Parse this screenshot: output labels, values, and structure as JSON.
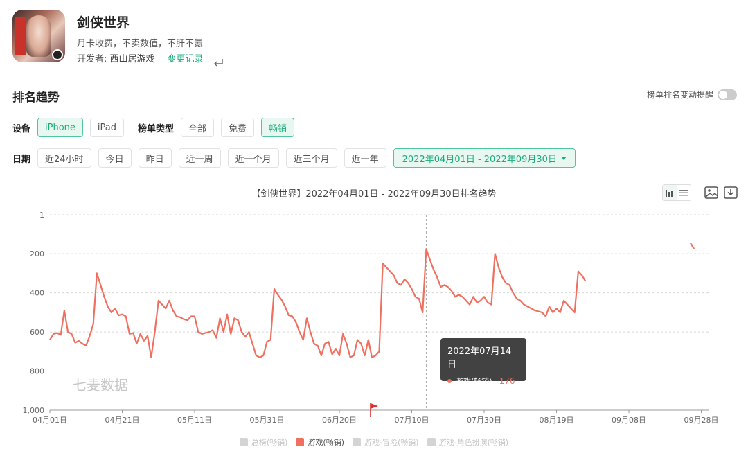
{
  "app": {
    "title": "剑侠世界",
    "description": "月卡收费，不卖数值，不肝不氪",
    "developer_label": "开发者: ",
    "developer": "西山居游戏",
    "change_log": "变更记录"
  },
  "section": {
    "title": "排名趋势",
    "alert_label": "榜单排名变动提醒"
  },
  "filters": {
    "device_label": "设备",
    "devices": [
      {
        "label": "iPhone",
        "active": true
      },
      {
        "label": "iPad",
        "active": false
      }
    ],
    "list_type_label": "榜单类型",
    "list_types": [
      {
        "label": "全部",
        "active": false
      },
      {
        "label": "免费",
        "active": false
      },
      {
        "label": "畅销",
        "active": true
      }
    ],
    "date_label": "日期",
    "dates": [
      "近24小时",
      "今日",
      "昨日",
      "近一周",
      "近一个月",
      "近三个月",
      "近一年"
    ],
    "date_range": "2022年04月01日 - 2022年09月30日"
  },
  "chart_title": "【剑侠世界】2022年04月01日 - 2022年09月30日排名趋势",
  "watermark": "七麦数据",
  "tooltip": {
    "date": "2022年07月14日",
    "series": "游戏(畅销)",
    "value": "176"
  },
  "legend": [
    {
      "label": "总榜(畅销)",
      "active": false
    },
    {
      "label": "游戏(畅销)",
      "active": true
    },
    {
      "label": "游戏-冒险(畅销)",
      "active": false
    },
    {
      "label": "游戏-角色扮演(畅销)",
      "active": false
    }
  ],
  "colors": {
    "accent": "#1aad7a",
    "series": "#f07060",
    "grid": "#d8d8d8"
  },
  "chart_data": {
    "type": "line",
    "title": "【剑侠世界】2022年04月01日 - 2022年09月30日排名趋势",
    "y_reversed": true,
    "ylim": [
      1,
      1000
    ],
    "yticks": [
      1,
      200,
      400,
      600,
      800,
      1000
    ],
    "ytick_labels": [
      "1",
      "200",
      "400",
      "600",
      "800",
      "1,000"
    ],
    "xlim": [
      "2022-04-01",
      "2022-09-30"
    ],
    "xticks": [
      "2022-04-01",
      "2022-04-21",
      "2022-05-11",
      "2022-05-31",
      "2022-06-20",
      "2022-07-10",
      "2022-07-30",
      "2022-08-19",
      "2022-09-08",
      "2022-09-28"
    ],
    "xtick_labels": [
      "04月01日",
      "04月21日",
      "05月11日",
      "05月31日",
      "06月20日",
      "07月10日",
      "07月30日",
      "08月19日",
      "09月08日",
      "09月28日"
    ],
    "grid": true,
    "legend_position": "bottom",
    "crosshair_date": "2022-07-14",
    "series": [
      {
        "name": "游戏(畅销)",
        "segments": [
          [
            [
              "2022-04-01",
              640
            ],
            [
              "2022-04-02",
              610
            ],
            [
              "2022-04-03",
              605
            ],
            [
              "2022-04-04",
              615
            ],
            [
              "2022-04-05",
              490
            ],
            [
              "2022-04-06",
              600
            ],
            [
              "2022-04-07",
              610
            ],
            [
              "2022-04-08",
              655
            ],
            [
              "2022-04-09",
              645
            ],
            [
              "2022-04-10",
              660
            ],
            [
              "2022-04-11",
              670
            ],
            [
              "2022-04-12",
              620
            ],
            [
              "2022-04-13",
              560
            ],
            [
              "2022-04-14",
              300
            ],
            [
              "2022-04-15",
              360
            ],
            [
              "2022-04-16",
              420
            ],
            [
              "2022-04-17",
              470
            ],
            [
              "2022-04-18",
              500
            ],
            [
              "2022-04-19",
              480
            ],
            [
              "2022-04-20",
              515
            ],
            [
              "2022-04-21",
              510
            ],
            [
              "2022-04-22",
              520
            ],
            [
              "2022-04-23",
              610
            ],
            [
              "2022-04-24",
              605
            ],
            [
              "2022-04-25",
              660
            ],
            [
              "2022-04-26",
              610
            ],
            [
              "2022-04-27",
              645
            ],
            [
              "2022-04-28",
              620
            ],
            [
              "2022-04-29",
              730
            ],
            [
              "2022-04-30",
              600
            ],
            [
              "2022-05-01",
              440
            ],
            [
              "2022-05-02",
              460
            ],
            [
              "2022-05-03",
              480
            ],
            [
              "2022-05-04",
              440
            ],
            [
              "2022-05-05",
              490
            ],
            [
              "2022-05-06",
              520
            ],
            [
              "2022-05-07",
              525
            ],
            [
              "2022-05-08",
              535
            ],
            [
              "2022-05-09",
              540
            ],
            [
              "2022-05-10",
              520
            ],
            [
              "2022-05-11",
              520
            ],
            [
              "2022-05-12",
              600
            ],
            [
              "2022-05-13",
              610
            ],
            [
              "2022-05-14",
              605
            ],
            [
              "2022-05-15",
              600
            ],
            [
              "2022-05-16",
              590
            ],
            [
              "2022-05-17",
              630
            ],
            [
              "2022-05-18",
              530
            ],
            [
              "2022-05-19",
              600
            ],
            [
              "2022-05-20",
              510
            ],
            [
              "2022-05-21",
              610
            ],
            [
              "2022-05-22",
              530
            ],
            [
              "2022-05-23",
              540
            ],
            [
              "2022-05-24",
              600
            ],
            [
              "2022-05-25",
              625
            ],
            [
              "2022-05-26",
              600
            ],
            [
              "2022-05-27",
              660
            ],
            [
              "2022-05-28",
              720
            ],
            [
              "2022-05-29",
              730
            ],
            [
              "2022-05-30",
              720
            ],
            [
              "2022-05-31",
              650
            ],
            [
              "2022-06-01",
              640
            ],
            [
              "2022-06-02",
              380
            ],
            [
              "2022-06-03",
              410
            ],
            [
              "2022-06-04",
              435
            ],
            [
              "2022-06-05",
              470
            ],
            [
              "2022-06-06",
              515
            ],
            [
              "2022-06-07",
              520
            ],
            [
              "2022-06-08",
              550
            ],
            [
              "2022-06-09",
              600
            ],
            [
              "2022-06-10",
              640
            ],
            [
              "2022-06-11",
              530
            ],
            [
              "2022-06-12",
              600
            ],
            [
              "2022-06-13",
              660
            ],
            [
              "2022-06-14",
              670
            ],
            [
              "2022-06-15",
              720
            ],
            [
              "2022-06-16",
              660
            ],
            [
              "2022-06-17",
              650
            ],
            [
              "2022-06-18",
              715
            ],
            [
              "2022-06-19",
              685
            ],
            [
              "2022-06-20",
              720
            ],
            [
              "2022-06-21",
              610
            ],
            [
              "2022-06-22",
              660
            ],
            [
              "2022-06-23",
              730
            ],
            [
              "2022-06-24",
              720
            ],
            [
              "2022-06-25",
              640
            ],
            [
              "2022-06-26",
              660
            ],
            [
              "2022-06-27",
              720
            ],
            [
              "2022-06-28",
              640
            ],
            [
              "2022-06-29",
              730
            ],
            [
              "2022-06-30",
              720
            ],
            [
              "2022-07-01",
              700
            ],
            [
              "2022-07-02",
              250
            ],
            [
              "2022-07-03",
              270
            ],
            [
              "2022-07-04",
              290
            ],
            [
              "2022-07-05",
              310
            ],
            [
              "2022-07-06",
              350
            ],
            [
              "2022-07-07",
              360
            ],
            [
              "2022-07-08",
              330
            ],
            [
              "2022-07-09",
              350
            ],
            [
              "2022-07-10",
              380
            ],
            [
              "2022-07-11",
              420
            ],
            [
              "2022-07-12",
              430
            ],
            [
              "2022-07-13",
              500
            ],
            [
              "2022-07-14",
              176
            ],
            [
              "2022-07-15",
              230
            ],
            [
              "2022-07-16",
              280
            ],
            [
              "2022-07-17",
              320
            ],
            [
              "2022-07-18",
              370
            ],
            [
              "2022-07-19",
              360
            ],
            [
              "2022-07-20",
              370
            ],
            [
              "2022-07-21",
              390
            ],
            [
              "2022-07-22",
              420
            ],
            [
              "2022-07-23",
              410
            ],
            [
              "2022-07-24",
              420
            ],
            [
              "2022-07-25",
              440
            ],
            [
              "2022-07-26",
              460
            ],
            [
              "2022-07-27",
              420
            ],
            [
              "2022-07-28",
              450
            ],
            [
              "2022-07-29",
              440
            ],
            [
              "2022-07-30",
              420
            ],
            [
              "2022-07-31",
              450
            ],
            [
              "2022-08-01",
              460
            ],
            [
              "2022-08-02",
              200
            ],
            [
              "2022-08-03",
              270
            ],
            [
              "2022-08-04",
              320
            ],
            [
              "2022-08-05",
              350
            ],
            [
              "2022-08-06",
              360
            ],
            [
              "2022-08-07",
              400
            ],
            [
              "2022-08-08",
              430
            ],
            [
              "2022-08-09",
              440
            ],
            [
              "2022-08-10",
              460
            ],
            [
              "2022-08-11",
              470
            ],
            [
              "2022-08-12",
              480
            ],
            [
              "2022-08-13",
              490
            ],
            [
              "2022-08-14",
              495
            ],
            [
              "2022-08-15",
              500
            ],
            [
              "2022-08-16",
              520
            ],
            [
              "2022-08-17",
              470
            ],
            [
              "2022-08-18",
              500
            ],
            [
              "2022-08-19",
              480
            ],
            [
              "2022-08-20",
              500
            ],
            [
              "2022-08-21",
              440
            ],
            [
              "2022-08-22",
              460
            ],
            [
              "2022-08-23",
              480
            ],
            [
              "2022-08-24",
              500
            ],
            [
              "2022-08-25",
              290
            ],
            [
              "2022-08-26",
              310
            ],
            [
              "2022-08-27",
              340
            ]
          ],
          [
            [
              "2022-09-25",
              145
            ],
            [
              "2022-09-26",
              175
            ]
          ]
        ]
      }
    ]
  }
}
